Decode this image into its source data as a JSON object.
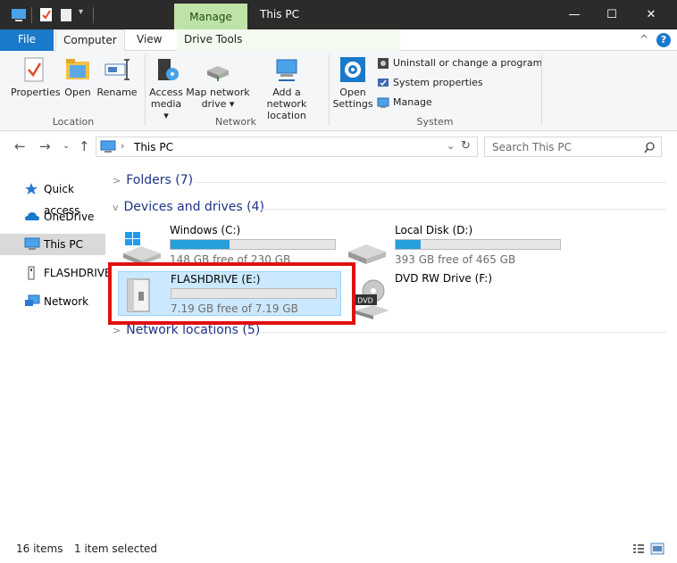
{
  "window": {
    "title": "This PC",
    "context_tab": "Manage",
    "minimize": "—",
    "maximize": "☐",
    "close": "✕"
  },
  "tabs": [
    {
      "label": "File"
    },
    {
      "label": "Computer"
    },
    {
      "label": "View"
    },
    {
      "label": "Drive Tools"
    }
  ],
  "ribbon": {
    "location": {
      "label": "Location",
      "properties": "Properties",
      "open": "Open",
      "rename": "Rename"
    },
    "network": {
      "label": "Network",
      "access_media_1": "Access",
      "access_media_2": "media ▾",
      "map_drive_1": "Map network",
      "map_drive_2": "drive ▾",
      "add_location_1": "Add a network",
      "add_location_2": "location"
    },
    "system": {
      "label": "System",
      "open_settings_1": "Open",
      "open_settings_2": "Settings",
      "uninstall": "Uninstall or change a program",
      "system_properties": "System properties",
      "manage": "Manage"
    },
    "collapse": "^",
    "help": "?"
  },
  "address": {
    "path": "This PC",
    "search_placeholder": "Search This PC"
  },
  "sidebar": {
    "items": [
      {
        "label": "Quick access"
      },
      {
        "label": "OneDrive"
      },
      {
        "label": "This PC"
      },
      {
        "label": "FLASHDRIVE"
      },
      {
        "label": "Network"
      }
    ]
  },
  "main": {
    "folders_header": "Folders (7)",
    "devices_header": "Devices and drives (4)",
    "network_header": "Network locations (5)",
    "drives": [
      {
        "name": "Windows (C:)",
        "free": "148 GB free of 230 GB",
        "used_fraction": 0.36
      },
      {
        "name": "Local Disk (D:)",
        "free": "393 GB free of 465 GB",
        "used_fraction": 0.15
      },
      {
        "name": "FLASHDRIVE (E:)",
        "free": "7.19 GB free of 7.19 GB",
        "used_fraction": 0.0
      },
      {
        "name": "DVD RW Drive (F:)"
      }
    ],
    "dvd_label": "DVD"
  },
  "status": {
    "items": "16 items",
    "selected": "1 item selected"
  },
  "colors": {
    "titlebar": "#2b2b2b",
    "manage_tab": "#bfe3a7",
    "file_tab": "#1979ca",
    "bar_fill": "#26a0da",
    "selection": "#cce8ff",
    "highlight_border": "#e01010"
  }
}
